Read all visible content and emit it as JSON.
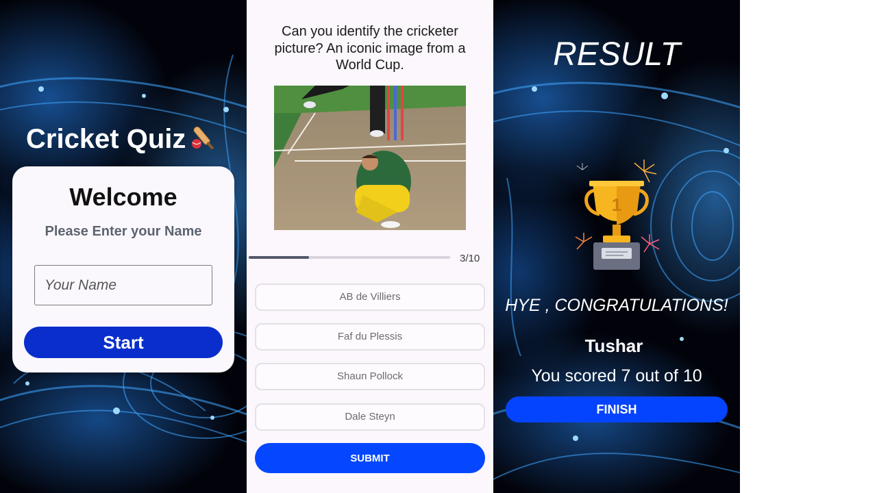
{
  "start_screen": {
    "app_title": "Cricket Quiz",
    "welcome_title": "Welcome",
    "subtitle": "Please Enter your Name",
    "name_placeholder": "Your Name",
    "start_label": "Start"
  },
  "question_screen": {
    "question": "Can you identify the cricketer picture? An iconic image from a World Cup.",
    "progress": {
      "current": 3,
      "total": 10,
      "label": "3/10"
    },
    "options": [
      "AB de Villiers",
      "Faf du Plessis",
      "Shaun Pollock",
      "Dale Steyn"
    ],
    "submit_label": "SUBMIT"
  },
  "result_screen": {
    "title": "RESULT",
    "congrats": "HYE , CONGRATULATIONS!",
    "player_name": "Tushar",
    "score_text": "You scored 7 out of 10",
    "finish_label": "FINISH"
  },
  "icons": {
    "app_title_icon": "cricket-bat-ball-icon",
    "result_icon": "trophy-fireworks-icon"
  },
  "colors": {
    "primary_button": "#0a2ecc",
    "accent_button": "#0547ff",
    "card_bg": "#fbf8fd",
    "progress_fill": "#545869"
  }
}
